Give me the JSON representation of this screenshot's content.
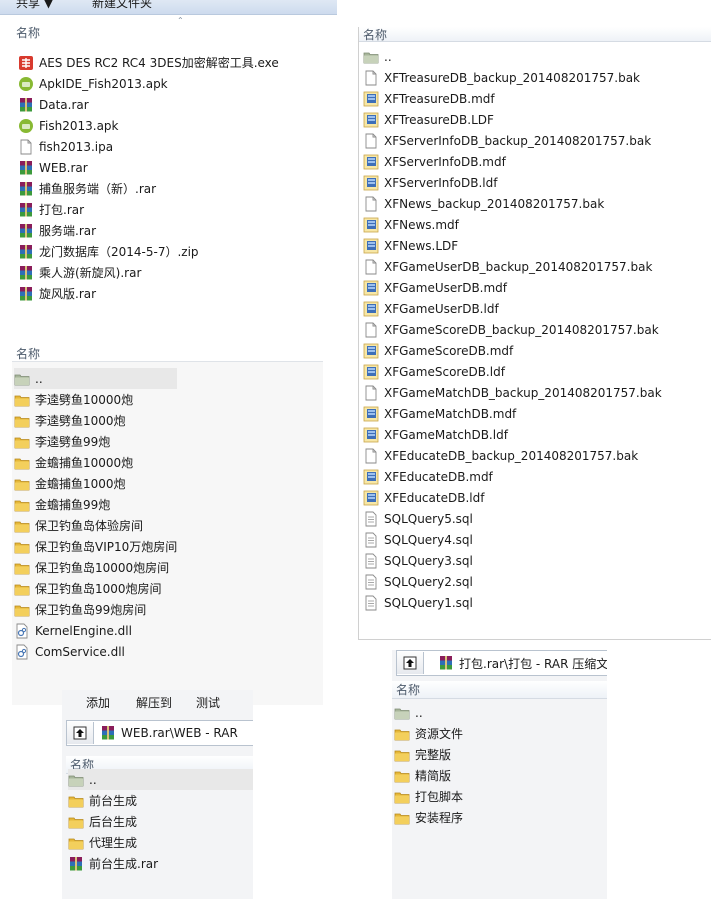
{
  "colors": {
    "folder": "#e6b83a",
    "rar": "#8a1d5a",
    "apk": "#88b933",
    "exe": "#d83a2e",
    "db": "#3e6fb8",
    "header_text": "#4c5a6b"
  },
  "panel1": {
    "toolbar": [
      "共享 ▼",
      "新建文件夹"
    ],
    "column_header": "名称",
    "files": [
      {
        "name": "AES DES RC2 RC4 3DES加密解密工具.exe",
        "icon": "exe-icon"
      },
      {
        "name": "ApkIDE_Fish2013.apk",
        "icon": "apk-icon"
      },
      {
        "name": "Data.rar",
        "icon": "rar-icon"
      },
      {
        "name": "Fish2013.apk",
        "icon": "apk-icon"
      },
      {
        "name": "fish2013.ipa",
        "icon": "document-icon"
      },
      {
        "name": "WEB.rar",
        "icon": "rar-icon"
      },
      {
        "name": "捕鱼服务端（新）.rar",
        "icon": "rar-icon"
      },
      {
        "name": "打包.rar",
        "icon": "rar-icon"
      },
      {
        "name": "服务端.rar",
        "icon": "rar-icon"
      },
      {
        "name": "龙门数据库（2014-5-7）.zip",
        "icon": "rar-icon"
      },
      {
        "name": "乘人游(新旋风).rar",
        "icon": "rar-icon"
      },
      {
        "name": "旋风版.rar",
        "icon": "rar-icon"
      }
    ]
  },
  "panel2": {
    "column_header": "名称",
    "files": [
      {
        "name": "..",
        "icon": "parent-folder-icon"
      },
      {
        "name": "李逵劈鱼10000炮",
        "icon": "folder-icon"
      },
      {
        "name": "李逵劈鱼1000炮",
        "icon": "folder-icon"
      },
      {
        "name": "李逵劈鱼99炮",
        "icon": "folder-icon"
      },
      {
        "name": "金蟾捕鱼10000炮",
        "icon": "folder-icon"
      },
      {
        "name": "金蟾捕鱼1000炮",
        "icon": "folder-icon"
      },
      {
        "name": "金蟾捕鱼99炮",
        "icon": "folder-icon"
      },
      {
        "name": "保卫钓鱼岛体验房间",
        "icon": "folder-icon"
      },
      {
        "name": "保卫钓鱼岛VIP10万炮房间",
        "icon": "folder-icon"
      },
      {
        "name": "保卫钓鱼岛10000炮房间",
        "icon": "folder-icon"
      },
      {
        "name": "保卫钓鱼岛1000炮房间",
        "icon": "folder-icon"
      },
      {
        "name": "保卫钓鱼岛99炮房间",
        "icon": "folder-icon"
      },
      {
        "name": "KernelEngine.dll",
        "icon": "dll-icon"
      },
      {
        "name": "ComService.dll",
        "icon": "dll-icon"
      }
    ]
  },
  "panel3": {
    "column_header": "名称",
    "files": [
      {
        "name": "..",
        "icon": "parent-folder-icon"
      },
      {
        "name": "XFTreasureDB_backup_201408201757.bak",
        "icon": "document-icon"
      },
      {
        "name": "XFTreasureDB.mdf",
        "icon": "db-icon"
      },
      {
        "name": "XFTreasureDB.LDF",
        "icon": "db-icon"
      },
      {
        "name": "XFServerInfoDB_backup_201408201757.bak",
        "icon": "document-icon"
      },
      {
        "name": "XFServerInfoDB.mdf",
        "icon": "db-icon"
      },
      {
        "name": "XFServerInfoDB.ldf",
        "icon": "db-icon"
      },
      {
        "name": "XFNews_backup_201408201757.bak",
        "icon": "document-icon"
      },
      {
        "name": "XFNews.mdf",
        "icon": "db-icon"
      },
      {
        "name": "XFNews.LDF",
        "icon": "db-icon"
      },
      {
        "name": "XFGameUserDB_backup_201408201757.bak",
        "icon": "document-icon"
      },
      {
        "name": "XFGameUserDB.mdf",
        "icon": "db-icon"
      },
      {
        "name": "XFGameUserDB.ldf",
        "icon": "db-icon"
      },
      {
        "name": "XFGameScoreDB_backup_201408201757.bak",
        "icon": "document-icon"
      },
      {
        "name": "XFGameScoreDB.mdf",
        "icon": "db-icon"
      },
      {
        "name": "XFGameScoreDB.ldf",
        "icon": "db-icon"
      },
      {
        "name": "XFGameMatchDB_backup_201408201757.bak",
        "icon": "document-icon"
      },
      {
        "name": "XFGameMatchDB.mdf",
        "icon": "db-icon"
      },
      {
        "name": "XFGameMatchDB.ldf",
        "icon": "db-icon"
      },
      {
        "name": "XFEducateDB_backup_201408201757.bak",
        "icon": "document-icon"
      },
      {
        "name": "XFEducateDB.mdf",
        "icon": "db-icon"
      },
      {
        "name": "XFEducateDB.ldf",
        "icon": "db-icon"
      },
      {
        "name": "SQLQuery5.sql",
        "icon": "sql-icon"
      },
      {
        "name": "SQLQuery4.sql",
        "icon": "sql-icon"
      },
      {
        "name": "SQLQuery3.sql",
        "icon": "sql-icon"
      },
      {
        "name": "SQLQuery2.sql",
        "icon": "sql-icon"
      },
      {
        "name": "SQLQuery1.sql",
        "icon": "sql-icon"
      }
    ]
  },
  "panel4": {
    "toolbar": [
      "添加",
      "解压到",
      "测试"
    ],
    "path": "WEB.rar\\WEB - RAR",
    "column_header": "名称",
    "files": [
      {
        "name": "..",
        "icon": "parent-folder-icon"
      },
      {
        "name": "前台生成",
        "icon": "folder-icon"
      },
      {
        "name": "后台生成",
        "icon": "folder-icon"
      },
      {
        "name": "代理生成",
        "icon": "folder-icon"
      },
      {
        "name": "前台生成.rar",
        "icon": "rar-icon"
      }
    ]
  },
  "panel5": {
    "path": "打包.rar\\打包 - RAR 压缩文",
    "column_header": "名称",
    "files": [
      {
        "name": "..",
        "icon": "parent-folder-icon"
      },
      {
        "name": "资源文件",
        "icon": "folder-icon"
      },
      {
        "name": "完整版",
        "icon": "folder-icon"
      },
      {
        "name": "精简版",
        "icon": "folder-icon"
      },
      {
        "name": "打包脚本",
        "icon": "folder-icon"
      },
      {
        "name": "安装程序",
        "icon": "folder-icon"
      }
    ]
  }
}
